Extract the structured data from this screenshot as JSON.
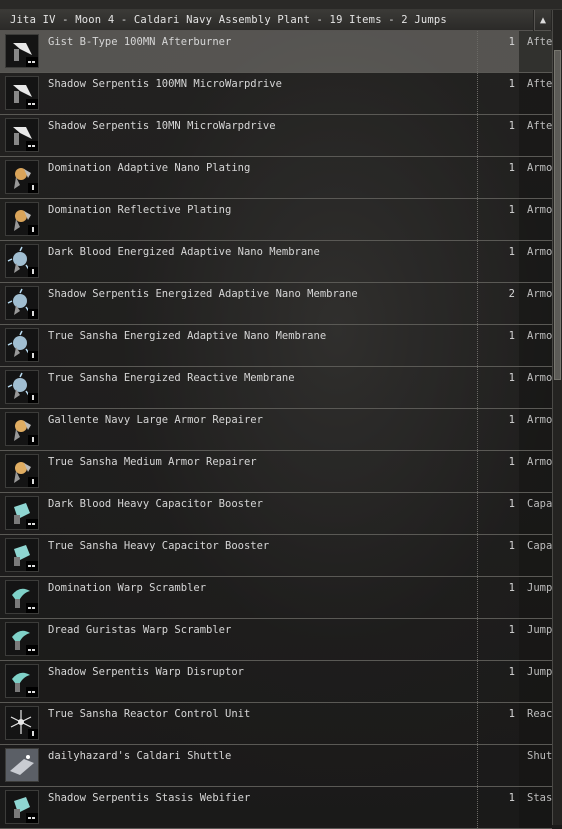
{
  "header": {
    "title": "Jita IV - Moon 4 - Caldari Navy Assembly Plant - 19 Items - 2 Jumps"
  },
  "items": [
    {
      "name": "Gist B-Type 100MN Afterburner",
      "qty": "1",
      "group": "After",
      "icon": "afterburner-icon",
      "selected": true
    },
    {
      "name": "Shadow Serpentis 100MN MicroWarpdrive",
      "qty": "1",
      "group": "After",
      "icon": "afterburner-icon"
    },
    {
      "name": "Shadow Serpentis 10MN MicroWarpdrive",
      "qty": "1",
      "group": "After",
      "icon": "afterburner-icon"
    },
    {
      "name": "Domination Adaptive Nano Plating",
      "qty": "1",
      "group": "Armo",
      "icon": "armor-plating-icon"
    },
    {
      "name": "Domination Reflective Plating",
      "qty": "1",
      "group": "Armo",
      "icon": "armor-plating-icon"
    },
    {
      "name": "Dark Blood Energized Adaptive Nano Membrane",
      "qty": "1",
      "group": "Armo",
      "icon": "energized-membrane-icon"
    },
    {
      "name": "Shadow Serpentis Energized Adaptive Nano Membrane",
      "qty": "2",
      "group": "Armo",
      "icon": "energized-membrane-icon"
    },
    {
      "name": "True Sansha Energized Adaptive Nano Membrane",
      "qty": "1",
      "group": "Armo",
      "icon": "energized-membrane-icon"
    },
    {
      "name": "True Sansha Energized Reactive Membrane",
      "qty": "1",
      "group": "Armo",
      "icon": "energized-membrane-icon"
    },
    {
      "name": "Gallente Navy Large Armor Repairer",
      "qty": "1",
      "group": "Armo",
      "icon": "armor-repairer-icon"
    },
    {
      "name": "True Sansha Medium Armor Repairer",
      "qty": "1",
      "group": "Armo",
      "icon": "armor-repairer-icon"
    },
    {
      "name": "Dark Blood Heavy Capacitor Booster",
      "qty": "1",
      "group": "Capa",
      "icon": "capacitor-booster-icon"
    },
    {
      "name": "True Sansha Heavy Capacitor Booster",
      "qty": "1",
      "group": "Capa",
      "icon": "capacitor-booster-icon"
    },
    {
      "name": "Domination Warp Scrambler",
      "qty": "1",
      "group": "Jump",
      "icon": "warp-scrambler-icon"
    },
    {
      "name": "Dread Guristas Warp Scrambler",
      "qty": "1",
      "group": "Jump",
      "icon": "warp-scrambler-icon"
    },
    {
      "name": "Shadow Serpentis Warp Disruptor",
      "qty": "1",
      "group": "Jump",
      "icon": "warp-scrambler-icon"
    },
    {
      "name": "True Sansha Reactor Control Unit",
      "qty": "1",
      "group": "Reac",
      "icon": "reactor-control-icon"
    },
    {
      "name": "dailyhazard's Caldari Shuttle",
      "qty": "",
      "group": "Shut",
      "icon": "shuttle-icon"
    },
    {
      "name": "Shadow Serpentis Stasis Webifier",
      "qty": "1",
      "group": "Stas",
      "icon": "stasis-webifier-icon"
    }
  ],
  "colors": {
    "afterburner-icon": "#e8e8e8",
    "armor-plating-icon": "#d9a45a",
    "energized-membrane-icon": "#b9dcf2",
    "armor-repairer-icon": "#e0ad62",
    "capacitor-booster-icon": "#8fd6d2",
    "warp-scrambler-icon": "#7fd1c8",
    "reactor-control-icon": "#e6e6e6",
    "stasis-webifier-icon": "#8fd6d2"
  }
}
